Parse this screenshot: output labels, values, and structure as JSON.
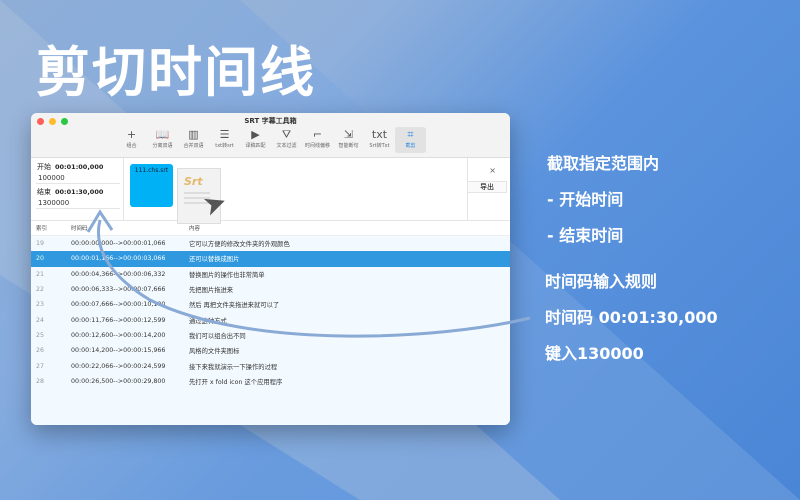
{
  "headline": "剪切时间线",
  "window": {
    "title": "SRT 字幕工具箱",
    "tools": [
      {
        "icon": "plus-icon",
        "glyph": "+",
        "label": "组合"
      },
      {
        "icon": "book-icon",
        "glyph": "📖",
        "label": "分离双语"
      },
      {
        "icon": "columns-icon",
        "glyph": "▥",
        "label": "合并双语"
      },
      {
        "icon": "list-icon",
        "glyph": "☰",
        "label": "txt转srt"
      },
      {
        "icon": "play-icon",
        "glyph": "▶",
        "label": "译稿匹配"
      },
      {
        "icon": "filter-icon",
        "glyph": "⛛",
        "label": "文本过滤"
      },
      {
        "icon": "crop-bracket-icon",
        "glyph": "⌐",
        "label": "时间线偏移"
      },
      {
        "icon": "arrows-icon",
        "glyph": "⇲",
        "label": "智能断句"
      },
      {
        "icon": "txt-icon",
        "glyph": "txt",
        "label": "Srt转Txt"
      },
      {
        "icon": "crop-icon",
        "glyph": "⌗",
        "label": "截剪"
      }
    ],
    "start_label": "开始",
    "start_time": "00:01:00,000",
    "start_value": "100000",
    "end_label": "结束",
    "end_time": "00:01:30,000",
    "end_value": "1300000",
    "file_name": "111.chs.srt",
    "doc_label": "Srt",
    "close": "×",
    "export": "导出",
    "columns": [
      "索引",
      "时间码",
      "内容"
    ],
    "rows": [
      [
        "19",
        "00:00:00,000-->00:00:01,066",
        "它可以方便的修改文件夹的外观颜色"
      ],
      [
        "20",
        "00:00:01,166-->00:00:03,066",
        "还可以替换成图片"
      ],
      [
        "21",
        "00:00:04,366-->00:00:06,332",
        "替换图片的操作也非常简单"
      ],
      [
        "22",
        "00:00:06,333-->00:00:07,666",
        "先把图片拖进来"
      ],
      [
        "23",
        "00:00:07,666-->00:00:10,100",
        "然后 再把文件夹拖进来就可以了"
      ],
      [
        "24",
        "00:00:11,766-->00:00:12,599",
        "通过这种方式"
      ],
      [
        "25",
        "00:00:12,600-->00:00:14,200",
        "我们可以组合出不同"
      ],
      [
        "26",
        "00:00:14,200-->00:00:15,966",
        "风格的文件夹图标"
      ],
      [
        "27",
        "00:00:22,066-->00:00:24,599",
        "接下来我就演示一下操作的过程"
      ],
      [
        "28",
        "00:00:26,500-->00:00:29,800",
        "先打开 x fold icon 这个应用程序"
      ]
    ],
    "selected_row": "20"
  },
  "notes": [
    "截取指定范围内",
    "- 开始时间",
    "- 结束时间",
    "时间码输入规则",
    "时间码 00:01:30,000",
    "键入130000"
  ]
}
